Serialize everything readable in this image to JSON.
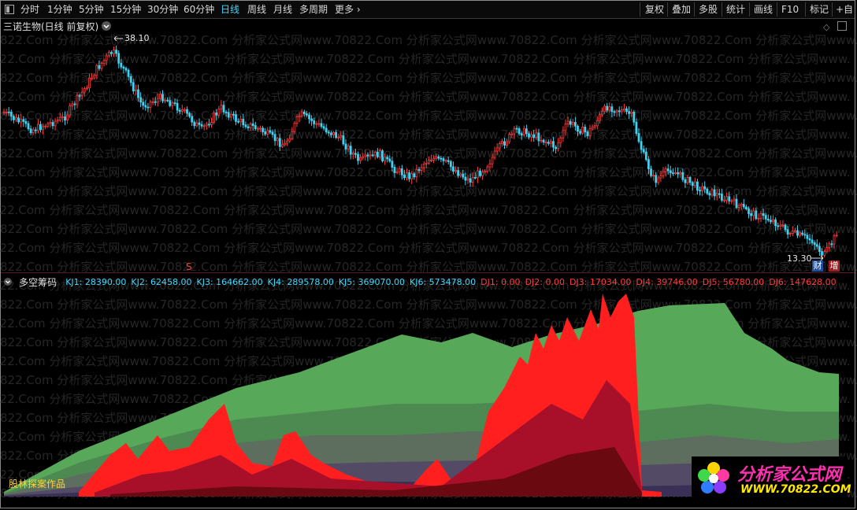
{
  "toolbar": {
    "left_items": [
      "分时",
      "1分钟",
      "5分钟",
      "15分钟",
      "30分钟",
      "60分钟",
      "日线",
      "周线",
      "月线",
      "多周期",
      "更多"
    ],
    "active": "日线",
    "right_items": [
      "复权",
      "叠加",
      "多股",
      "统计",
      "画线",
      "F10",
      "标记",
      "+自"
    ]
  },
  "main_panel": {
    "title": "三诺生物(日线 前复权)",
    "max_label": "38.10",
    "min_label": "13.30",
    "signal_s": "S",
    "badge_cai": "财",
    "badge_zeng": "增",
    "colors": {
      "up": "#ff3b3b",
      "down": "#40d0f0",
      "panel_title": "#e0e0e0"
    }
  },
  "indicator_panel": {
    "title": "多空筹码",
    "values": [
      {
        "name": "KJ1",
        "value": "28390.00",
        "color": "#3fd8ff"
      },
      {
        "name": "KJ2",
        "value": "62458.00",
        "color": "#3fd8ff"
      },
      {
        "name": "KJ3",
        "value": "164662.00",
        "color": "#3fd8ff"
      },
      {
        "name": "KJ4",
        "value": "289578.00",
        "color": "#3fd8ff"
      },
      {
        "name": "KJ5",
        "value": "369070.00",
        "color": "#3fd8ff"
      },
      {
        "name": "KJ6",
        "value": "573478.00",
        "color": "#3fd8ff"
      },
      {
        "name": "DJ1",
        "value": "0.00",
        "color": "#ff3b3b"
      },
      {
        "name": "DJ2",
        "value": "0.00",
        "color": "#ff3b3b"
      },
      {
        "name": "DJ3",
        "value": "17034.00",
        "color": "#ff3b3b"
      },
      {
        "name": "DJ4",
        "value": "39746.00",
        "color": "#ff3b3b"
      },
      {
        "name": "DJ5",
        "value": "56780.00",
        "color": "#ff3b3b"
      },
      {
        "name": "DJ6",
        "value": "147628.00",
        "color": "#ff3b3b"
      }
    ],
    "footer_text": "股林探案作品"
  },
  "watermark": {
    "text": "822.Com 分析家公式网www.70822.Com 分析家公式网www.70822.Com 分析家公式网www.70822.Com 分析家公式网www.70822.Com 分析家公式网www.70822.Com",
    "logo_title": "分析家公式网",
    "logo_url": "WWW.70822.COM"
  }
}
